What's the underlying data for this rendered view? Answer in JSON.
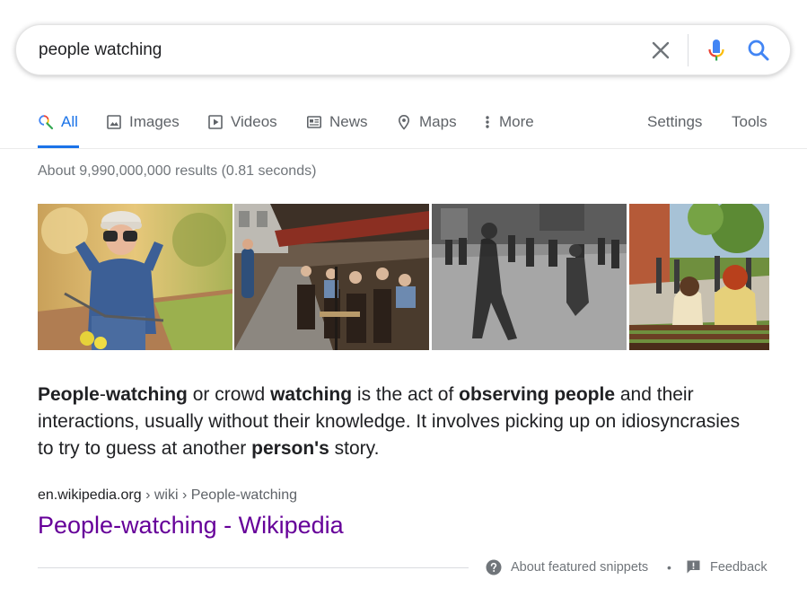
{
  "search": {
    "query": "people watching"
  },
  "tabs": {
    "items": [
      {
        "label": "All",
        "icon": "search-icon",
        "active": true
      },
      {
        "label": "Images",
        "icon": "image-icon"
      },
      {
        "label": "Videos",
        "icon": "video-icon"
      },
      {
        "label": "News",
        "icon": "newspaper-icon"
      },
      {
        "label": "Maps",
        "icon": "map-pin-icon"
      },
      {
        "label": "More",
        "icon": "more-vertical-icon"
      }
    ],
    "settings_label": "Settings",
    "tools_label": "Tools"
  },
  "results": {
    "stats": "About 9,990,000,000 results (0.81 seconds)"
  },
  "snippet": {
    "parts": [
      {
        "t": "People",
        "b": true
      },
      {
        "t": "-",
        "b": false
      },
      {
        "t": "watching",
        "b": true
      },
      {
        "t": " or crowd ",
        "b": false
      },
      {
        "t": "watching",
        "b": true
      },
      {
        "t": " is the act of ",
        "b": false
      },
      {
        "t": "observing people",
        "b": true
      },
      {
        "t": " and their interactions, usually without their knowledge. It involves picking up on idiosyncrasies to try to guess at another ",
        "b": false
      },
      {
        "t": "person's",
        "b": true
      },
      {
        "t": " story.",
        "b": false
      }
    ]
  },
  "source": {
    "domain": "en.wikipedia.org",
    "path": " › wiki › People-watching",
    "title": "People-watching - Wikipedia"
  },
  "footer": {
    "about_snippets": "About featured snippets",
    "separator": "•",
    "feedback": "Feedback"
  },
  "colors": {
    "accent": "#1a73e8",
    "link_visited": "#660099",
    "muted": "#70757a"
  }
}
